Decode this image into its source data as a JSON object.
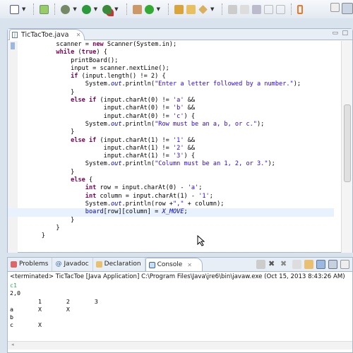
{
  "toolbar": {
    "icons": [
      "checkbox-icon",
      "new-class-icon",
      "debug-icon",
      "run-icon",
      "external-tools-icon",
      "build-icon",
      "refresh-icon",
      "open-type-icon",
      "open-folder-icon",
      "pen-icon",
      "annotation-icon",
      "edit-icon",
      "tasks-icon",
      "block-icon",
      "paragraph-icon",
      "java-icon"
    ]
  },
  "editor": {
    "tab_label": "TicTacToe.java",
    "lines": [
      "        scanner = new Scanner(System.in);",
      "        while (true) {",
      "            printBoard();",
      "            input = scanner.nextLine();",
      "            if (input.length() != 2) {",
      "                System.out.println(\"Enter a letter followed by a number.\");",
      "            }",
      "            else if (input.charAt(0) != 'a' &&",
      "                     input.charAt(0) != 'b' &&",
      "                     input.charAt(0) != 'c') {",
      "                System.out.println(\"Row must be an a, b, or c.\");",
      "            }",
      "            else if (input.charAt(1) != '1' &&",
      "                     input.charAt(1) != '2' &&",
      "                     input.charAt(1) != '3') {",
      "                System.out.println(\"Column must be an 1, 2, or 3.\");",
      "            }",
      "            else {",
      "                int row = input.charAt(0) - 'a';",
      "                int column = input.charAt(1) - '1';",
      "                System.out.println(row +\",\" + column);",
      "                board[row][column] = X_MOVE;",
      "            }",
      "        }",
      "    }"
    ],
    "highlighted_line": 21
  },
  "bottom": {
    "tabs": [
      {
        "label": "Problems"
      },
      {
        "label": "Javadoc"
      },
      {
        "label": "Declaration"
      },
      {
        "label": "Console",
        "active": true
      }
    ],
    "console_header": "<terminated> TicTacToe [Java Application] C:\\Program Files\\Java\\jre6\\bin\\javaw.exe (Oct 15, 2013 8:43:26 AM)",
    "output": [
      "c1",
      "2,0",
      "        1       2       3",
      "a       X       X",
      "b",
      "c       X"
    ],
    "input_color": "#33aa66"
  },
  "colors": {
    "keyword": "#7f0055",
    "string": "#2a00ff",
    "field": "#0000c0",
    "highlight": "#e8f2fe"
  }
}
